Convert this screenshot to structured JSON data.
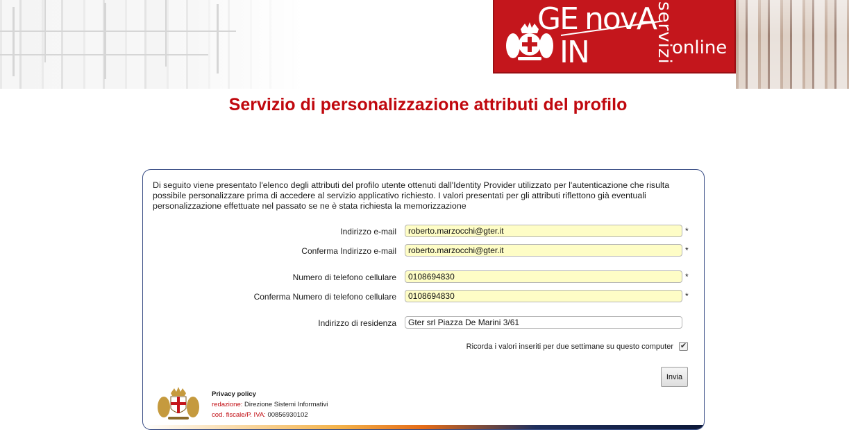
{
  "header": {
    "logo": {
      "ge": "GE",
      "nova": "novA",
      "in": "IN",
      "servizi": "servizi",
      "online": "online",
      "crest_icon": "genova-crest-icon"
    }
  },
  "title": "Servizio di personalizzazione attributi del profilo",
  "intro": "Di seguito viene presentato l'elenco degli attributi del profilo utente ottenuti dall'Identity Provider utilizzato per l'autenticazione che risulta possibile personalizzare prima di accedere al servizio applicativo richiesto. I valori presentati per gli attributi riflettono già eventuali personalizzazione effettuate nel passato se ne è stata richiesta la memorizzazione",
  "fields": {
    "email": {
      "label": "Indirizzo e-mail",
      "value": "roberto.marzocchi@gter.it",
      "required_mark": "*"
    },
    "email_confirm": {
      "label": "Conferma Indirizzo e-mail",
      "value": "roberto.marzocchi@gter.it",
      "required_mark": "*"
    },
    "phone": {
      "label": "Numero di telefono cellulare",
      "value": "0108694830",
      "required_mark": "*"
    },
    "phone_confirm": {
      "label": "Conferma Numero di telefono cellulare",
      "value": "0108694830",
      "required_mark": "*"
    },
    "address": {
      "label": "Indirizzo di residenza",
      "value": "Gter srl Piazza De Marini 3/61"
    }
  },
  "remember": {
    "label": "Ricorda i valori inseriti per due settimane su questo computer",
    "checked": true,
    "check_glyph": "✔"
  },
  "submit_label": "Invia",
  "footer": {
    "privacy": "Privacy policy",
    "redazione_key": "redazione:",
    "redazione_value": "Direzione Sistemi Informativi",
    "cf_key": "cod. fiscale/P. IVA:",
    "cf_value": "00856930102",
    "crest_icon": "genova-crest-icon"
  },
  "colors": {
    "brand_red": "#c4161c",
    "title_red": "#c0080e",
    "required_bg": "#fefdc6",
    "panel_border": "#3a4e86"
  }
}
